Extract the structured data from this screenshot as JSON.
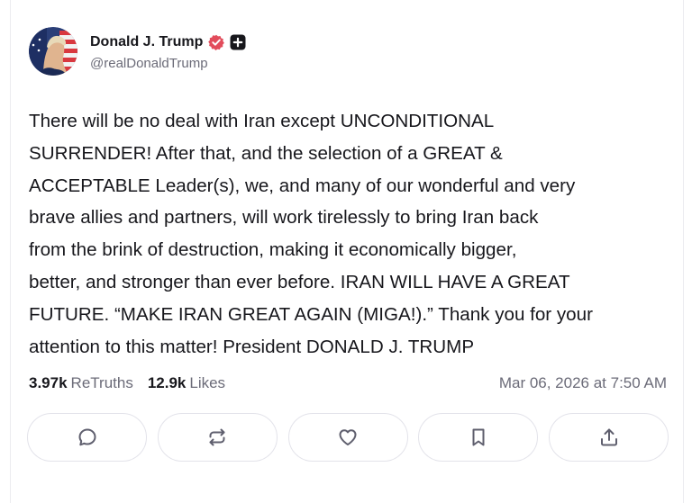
{
  "author": {
    "display_name": "Donald J. Trump",
    "handle": "@realDonaldTrump"
  },
  "post": {
    "text": "There will be no deal with Iran except UNCONDITIONAL\nSURRENDER! After that, and the selection of a GREAT &\nACCEPTABLE Leader(s), we, and many of our wonderful and very\nbrave allies and partners, will work tirelessly to bring Iran back\nfrom the brink of destruction, making it economically bigger,\nbetter, and stronger than ever before. IRAN WILL HAVE A GREAT\nFUTURE. “MAKE IRAN GREAT AGAIN (MIGA!).” Thank you for your\nattention to this matter! President DONALD J. TRUMP",
    "retruths_count": "3.97k",
    "retruths_label": "ReTruths",
    "likes_count": "12.9k",
    "likes_label": "Likes",
    "timestamp": "Mar 06, 2026 at 7:50 AM"
  },
  "colors": {
    "verified_badge": "#e24c5b",
    "text_primary": "#17171c",
    "text_secondary": "#6b6b78",
    "button_border": "#e3e3ea"
  },
  "actions": [
    {
      "icon": "reply-icon"
    },
    {
      "icon": "retruth-icon"
    },
    {
      "icon": "like-icon"
    },
    {
      "icon": "bookmark-icon"
    },
    {
      "icon": "share-icon"
    }
  ]
}
